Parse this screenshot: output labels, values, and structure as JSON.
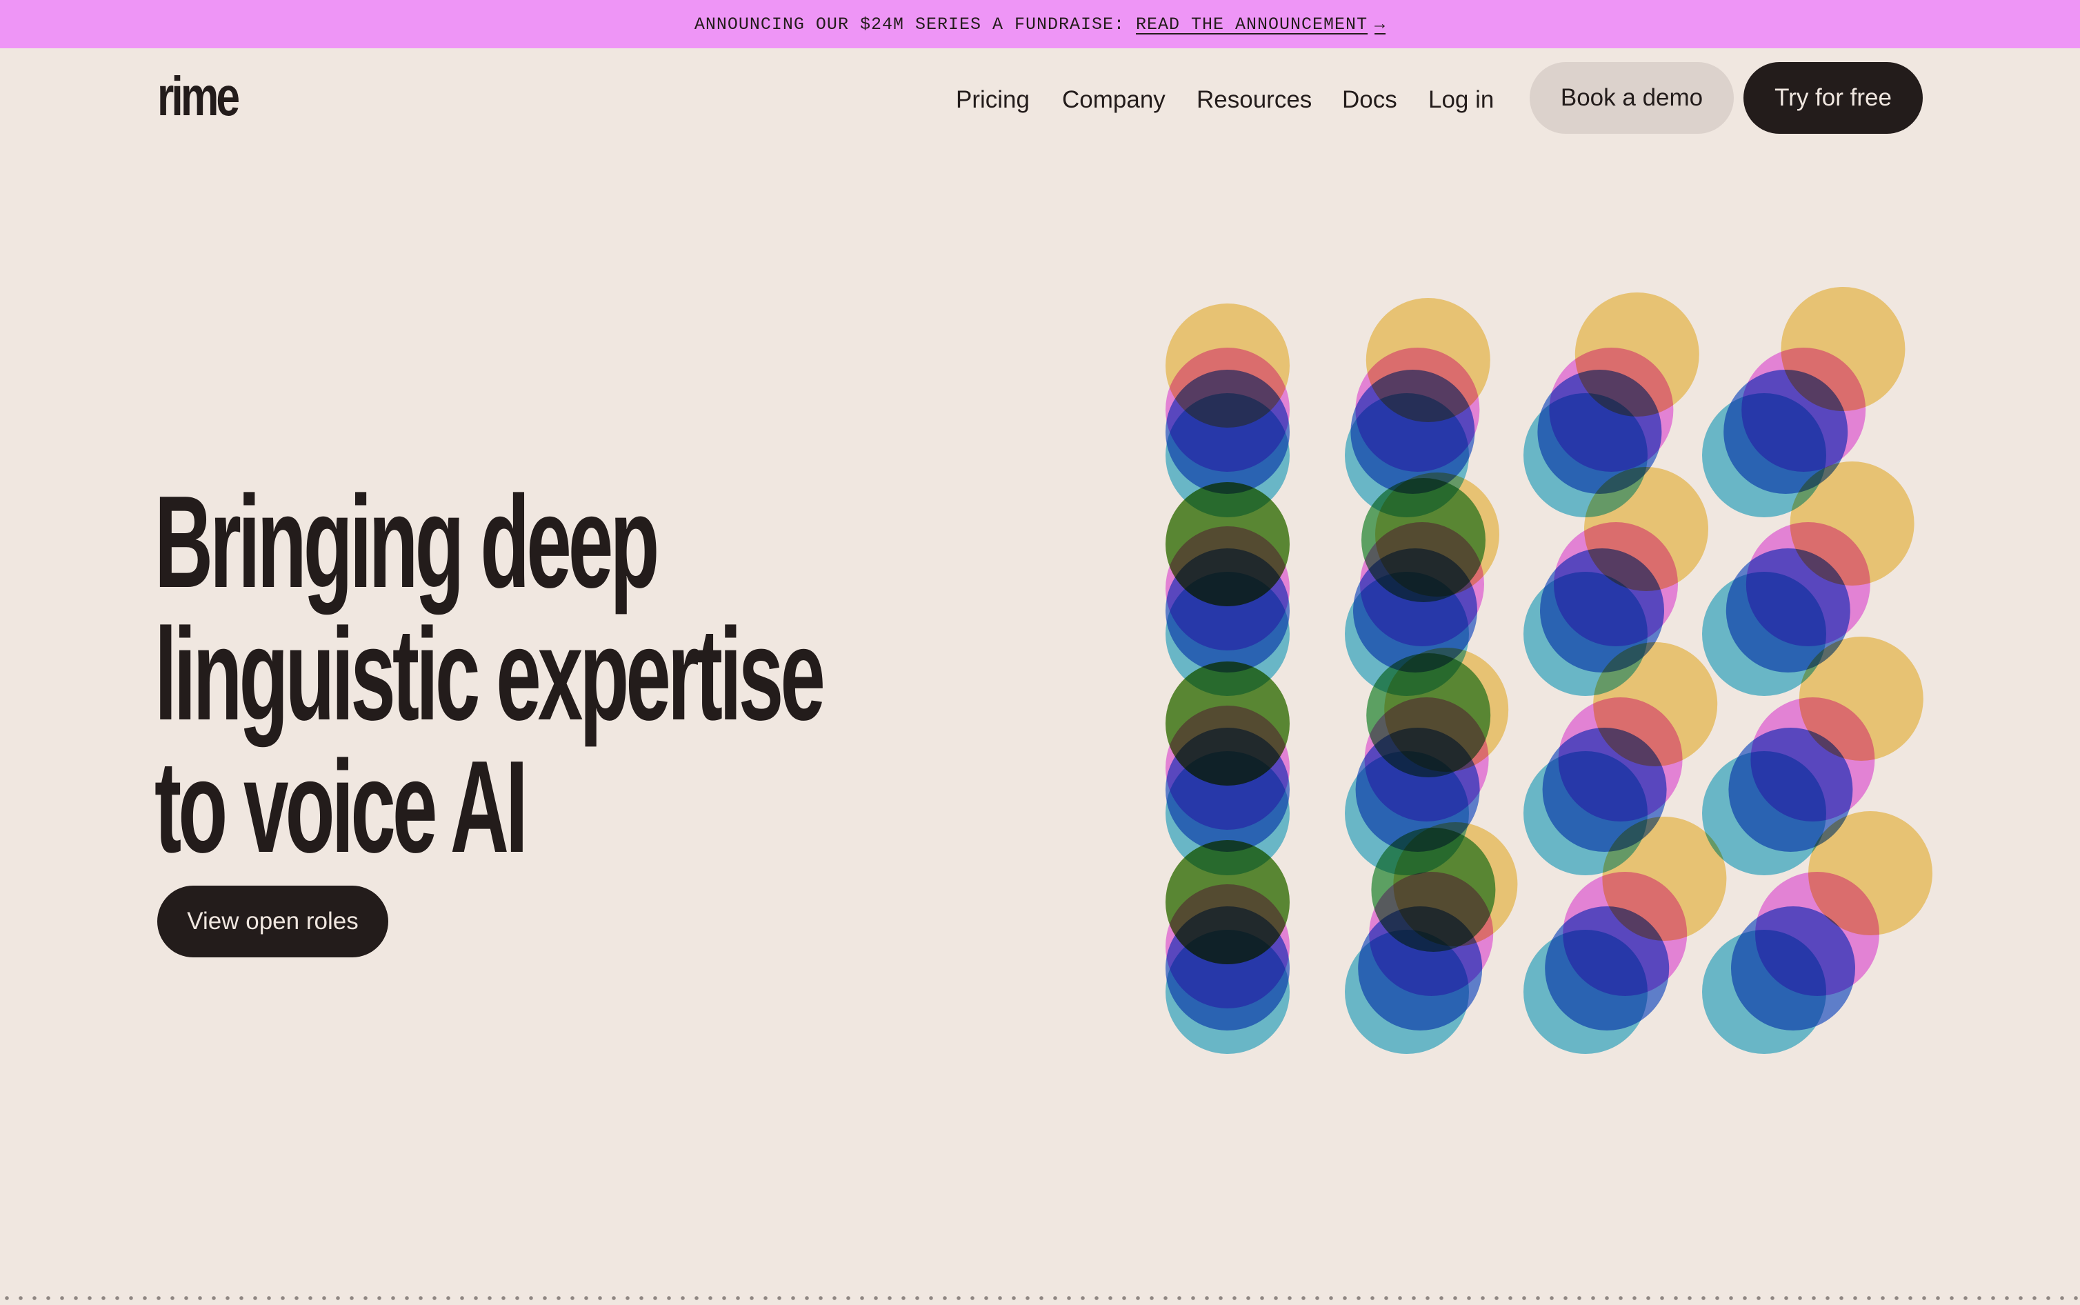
{
  "announcement": {
    "text": "ANNOUNCING OUR $24M SERIES A FUNDRAISE:",
    "link_label": "READ THE ANNOUNCEMENT",
    "arrow": "→"
  },
  "header": {
    "logo": "rime",
    "nav": [
      {
        "label": "Pricing"
      },
      {
        "label": "Company"
      },
      {
        "label": "Resources"
      },
      {
        "label": "Docs"
      },
      {
        "label": "Log in"
      }
    ],
    "demo_label": "Book a demo",
    "try_label": "Try for free"
  },
  "hero": {
    "headline_lines": [
      "Bringing deep",
      "linguistic expertise",
      "to voice AI"
    ],
    "cta_label": "View open roles"
  },
  "colors": {
    "background": "#f0e7e0",
    "banner": "#ee95f6",
    "text_dark": "#231c1b",
    "button_light": "#dcd2cc",
    "circle_yellow": "#f5d47c",
    "circle_magenta": "#ee7bf0",
    "circle_red": "#e8776f",
    "circle_green": "#5aad68",
    "circle_blue": "#4977e0",
    "circle_cyan": "#68c6e0",
    "overlap_dark": "#40605f"
  }
}
